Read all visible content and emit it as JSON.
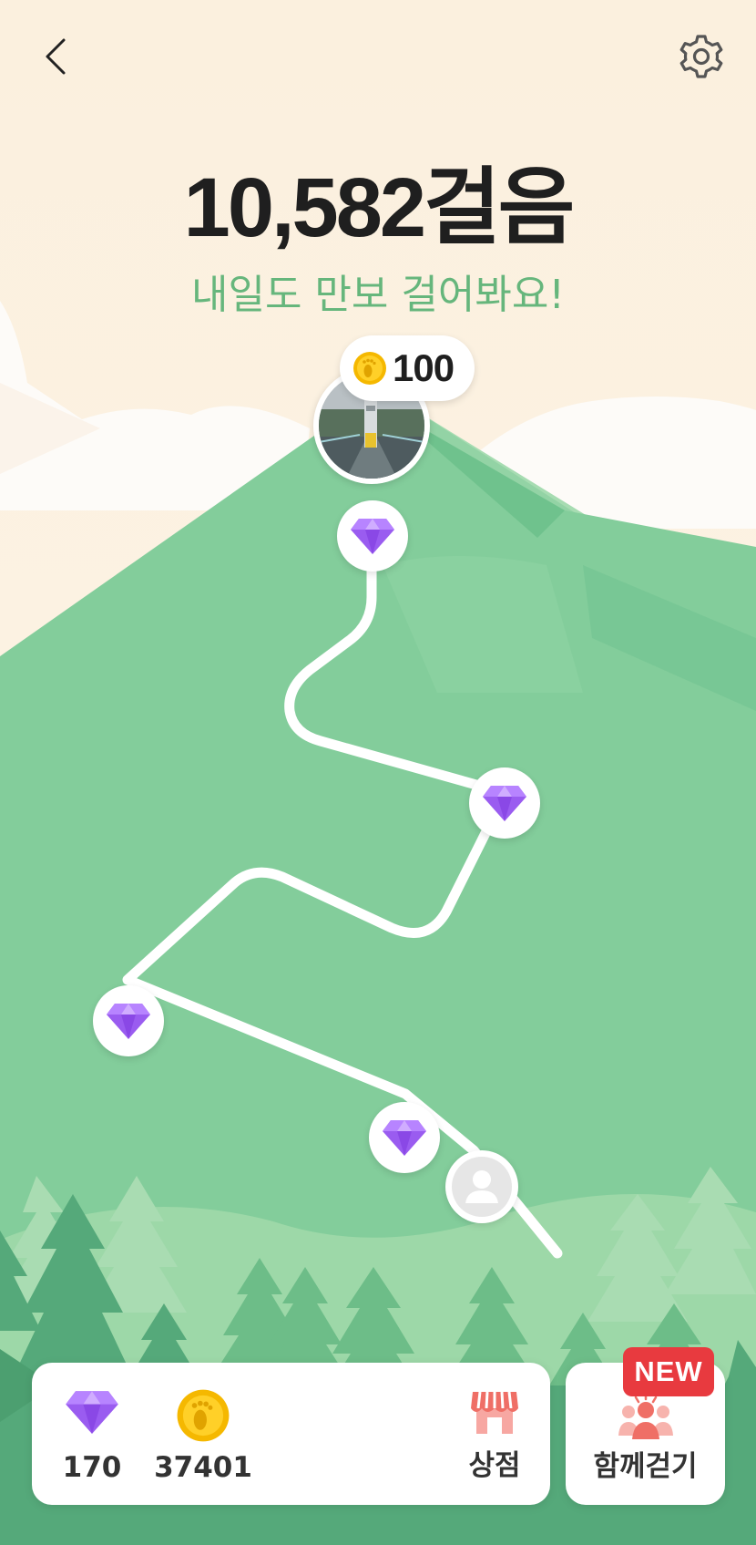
{
  "header": {
    "back_icon": "chevron-left-icon",
    "settings_icon": "gear-icon"
  },
  "progress": {
    "steps_text": "10,582걸음",
    "message": "내일도 만보 걸어봐요!"
  },
  "goal": {
    "reward_icon": "footprint-coin-icon",
    "reward_value": "100",
    "photo": "bridge-photo"
  },
  "path": {
    "milestones": [
      "diamond-icon",
      "diamond-icon",
      "diamond-icon",
      "diamond-icon"
    ],
    "current_position_icon": "user-avatar-icon"
  },
  "wallet": {
    "diamonds": "170",
    "coins": "37401",
    "shop_label": "상점"
  },
  "walk_together": {
    "label": "함께걷기",
    "badge": "NEW"
  },
  "colors": {
    "background": "#fbf0de",
    "mountain": "#82cd9c",
    "accent_text": "#66b67c",
    "diamond": "#9a5cf0",
    "badge": "#e83a3f"
  }
}
